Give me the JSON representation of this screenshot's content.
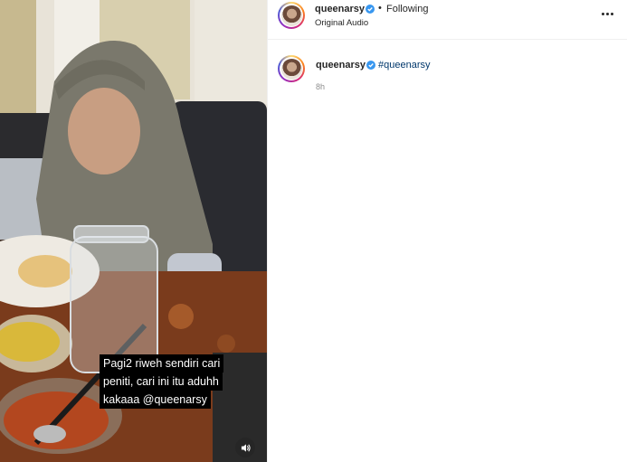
{
  "post": {
    "username": "queenarsy",
    "verified": true,
    "separator": "•",
    "follow_status": "Following",
    "audio": "Original Audio",
    "more_icon": "more-horizontal-icon"
  },
  "comment": {
    "username": "queenarsy",
    "verified": true,
    "hashtag": "#queenarsy",
    "time": "8h"
  },
  "video": {
    "caption_lines": [
      "Pagi2 riweh sendiri cari",
      "peniti, cari ini itu aduhh",
      "kakaaa @queenarsy"
    ],
    "audio_icon": "speaker-icon"
  },
  "colors": {
    "verified": "#3897f0",
    "hashtag": "#00376b",
    "timestamp": "#8e8e8e"
  }
}
